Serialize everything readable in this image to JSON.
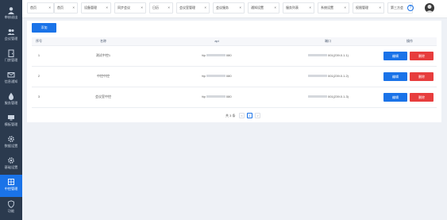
{
  "sidebar": {
    "items": [
      {
        "label": "审核退出",
        "icon": "user-icon"
      },
      {
        "label": "会议管理",
        "icon": "people-icon"
      },
      {
        "label": "门禁管理",
        "icon": "door-icon"
      },
      {
        "label": "信息通知",
        "icon": "envelope-icon"
      },
      {
        "label": "服务管理",
        "icon": "drop-icon"
      },
      {
        "label": "模板管理",
        "icon": "monitor-icon"
      },
      {
        "label": "数据设置",
        "icon": "gear-icon"
      },
      {
        "label": "基础设置",
        "icon": "gear-icon"
      },
      {
        "label": "中控管理",
        "icon": "control-icon",
        "active": true
      },
      {
        "label": "功能",
        "icon": "shield-icon"
      }
    ]
  },
  "tabs": [
    {
      "label": "首页"
    },
    {
      "label": "首页"
    },
    {
      "label": "设备管理"
    },
    {
      "label": "同步会议"
    },
    {
      "label": "日历"
    },
    {
      "label": "会议室管理"
    },
    {
      "label": "会议服务"
    },
    {
      "label": "通知设置"
    },
    {
      "label": "服务列表"
    },
    {
      "label": "系统设置"
    },
    {
      "label": "权限管理"
    },
    {
      "label": "第三方会"
    }
  ],
  "toolbar": {
    "add_label": "添加"
  },
  "table": {
    "headers": [
      "序号",
      "名称",
      "api",
      "端口",
      "操作"
    ],
    "rows": [
      {
        "index": "1",
        "name": "测试中控1",
        "api_prefix": "ttp",
        "api_suffix": "080",
        "port_suffix": "001(239.0.1.1)"
      },
      {
        "index": "2",
        "name": "中控中控",
        "api_prefix": "ttp",
        "api_suffix": "080",
        "port_suffix": "001(239.0.1.2)"
      },
      {
        "index": "3",
        "name": "会议室中控",
        "api_prefix": "ttp",
        "api_suffix": "080",
        "port_suffix": "001(239.0.1.3)"
      }
    ],
    "edit_label": "编辑",
    "delete_label": "删除"
  },
  "pagination": {
    "total_text": "共 3 条",
    "prev": "<",
    "current": "1",
    "next": ">"
  },
  "header": {
    "help_glyph": "?"
  },
  "colors": {
    "accent": "#1a73e8",
    "danger": "#e73d3d",
    "sidebar": "#2b3a4e"
  }
}
